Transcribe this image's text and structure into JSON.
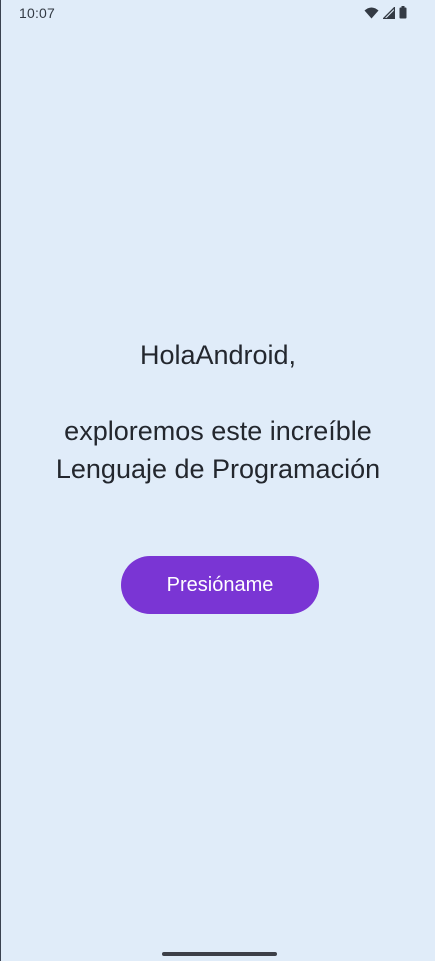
{
  "status_bar": {
    "time": "10:07",
    "icons": [
      "wifi-icon",
      "cellular-signal-icon",
      "battery-icon"
    ]
  },
  "main": {
    "greeting_line1": "HolaAndroid,",
    "greeting_line2": "exploremos este increíble",
    "greeting_line3": "Lenguaje de Programación",
    "button_label": "Presióname"
  },
  "colors": {
    "background": "#e0ecf9",
    "button": "#7a35d4",
    "text": "#23272e"
  }
}
